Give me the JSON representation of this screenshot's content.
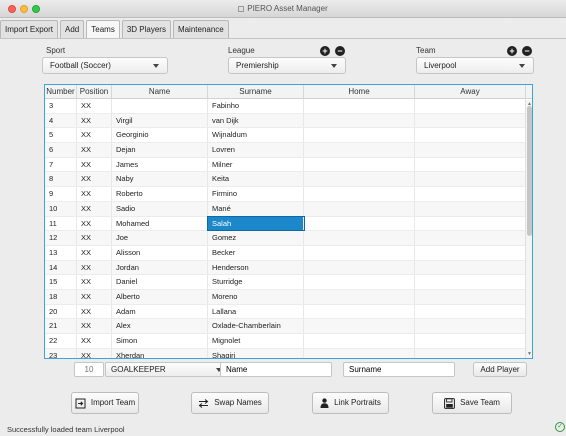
{
  "window": {
    "title": "PIERO Asset Manager"
  },
  "tabs": [
    "Import Export",
    "Add",
    "Teams",
    "3D Players",
    "Maintenance"
  ],
  "active_tab": "Teams",
  "filters": {
    "sport": {
      "label": "Sport",
      "value": "Football (Soccer)"
    },
    "league": {
      "label": "League",
      "value": "Premiership"
    },
    "team": {
      "label": "Team",
      "value": "Liverpool"
    }
  },
  "table": {
    "columns": [
      "Number",
      "Position",
      "Name",
      "Surname",
      "Home",
      "Away"
    ],
    "rows": [
      [
        "3",
        "XX",
        "",
        "Fabinho",
        "",
        ""
      ],
      [
        "4",
        "XX",
        "Virgil",
        "van Dijk",
        "",
        ""
      ],
      [
        "5",
        "XX",
        "Georginio",
        "Wijnaldum",
        "",
        ""
      ],
      [
        "6",
        "XX",
        "Dejan",
        "Lovren",
        "",
        ""
      ],
      [
        "7",
        "XX",
        "James",
        "Milner",
        "",
        ""
      ],
      [
        "8",
        "XX",
        "Naby",
        "Keita",
        "",
        ""
      ],
      [
        "9",
        "XX",
        "Roberto",
        "Firmino",
        "",
        ""
      ],
      [
        "10",
        "XX",
        "Sadio",
        "Mané",
        "",
        ""
      ],
      [
        "11",
        "XX",
        "Mohamed",
        "Salah",
        "",
        ""
      ],
      [
        "12",
        "XX",
        "Joe",
        "Gomez",
        "",
        ""
      ],
      [
        "13",
        "XX",
        "Alisson",
        "Becker",
        "",
        ""
      ],
      [
        "14",
        "XX",
        "Jordan",
        "Henderson",
        "",
        ""
      ],
      [
        "15",
        "XX",
        "Daniel",
        "Sturridge",
        "",
        ""
      ],
      [
        "18",
        "XX",
        "Alberto",
        "Moreno",
        "",
        ""
      ],
      [
        "20",
        "XX",
        "Adam",
        "Lallana",
        "",
        ""
      ],
      [
        "21",
        "XX",
        "Alex",
        "Oxlade-Chamberlain",
        "",
        ""
      ],
      [
        "22",
        "XX",
        "Simon",
        "Mignolet",
        "",
        ""
      ],
      [
        "23",
        "XX",
        "Xherdan",
        "Shaqiri",
        "",
        ""
      ]
    ],
    "selected": {
      "row": 8,
      "col": 3
    }
  },
  "add_row": {
    "number_placeholder": "10",
    "position_value": "GOALKEEPER",
    "name_value": "Name",
    "surname_value": "Surname",
    "add_label": "Add Player"
  },
  "actions": {
    "import_label": "Import Team",
    "swap_label": "Swap Names",
    "link_label": "Link Portraits",
    "save_label": "Save Team"
  },
  "status": {
    "message": "Successfully loaded team Liverpool"
  },
  "colors": {
    "selection": "#1d88c9",
    "table_border": "#3da3e0"
  }
}
